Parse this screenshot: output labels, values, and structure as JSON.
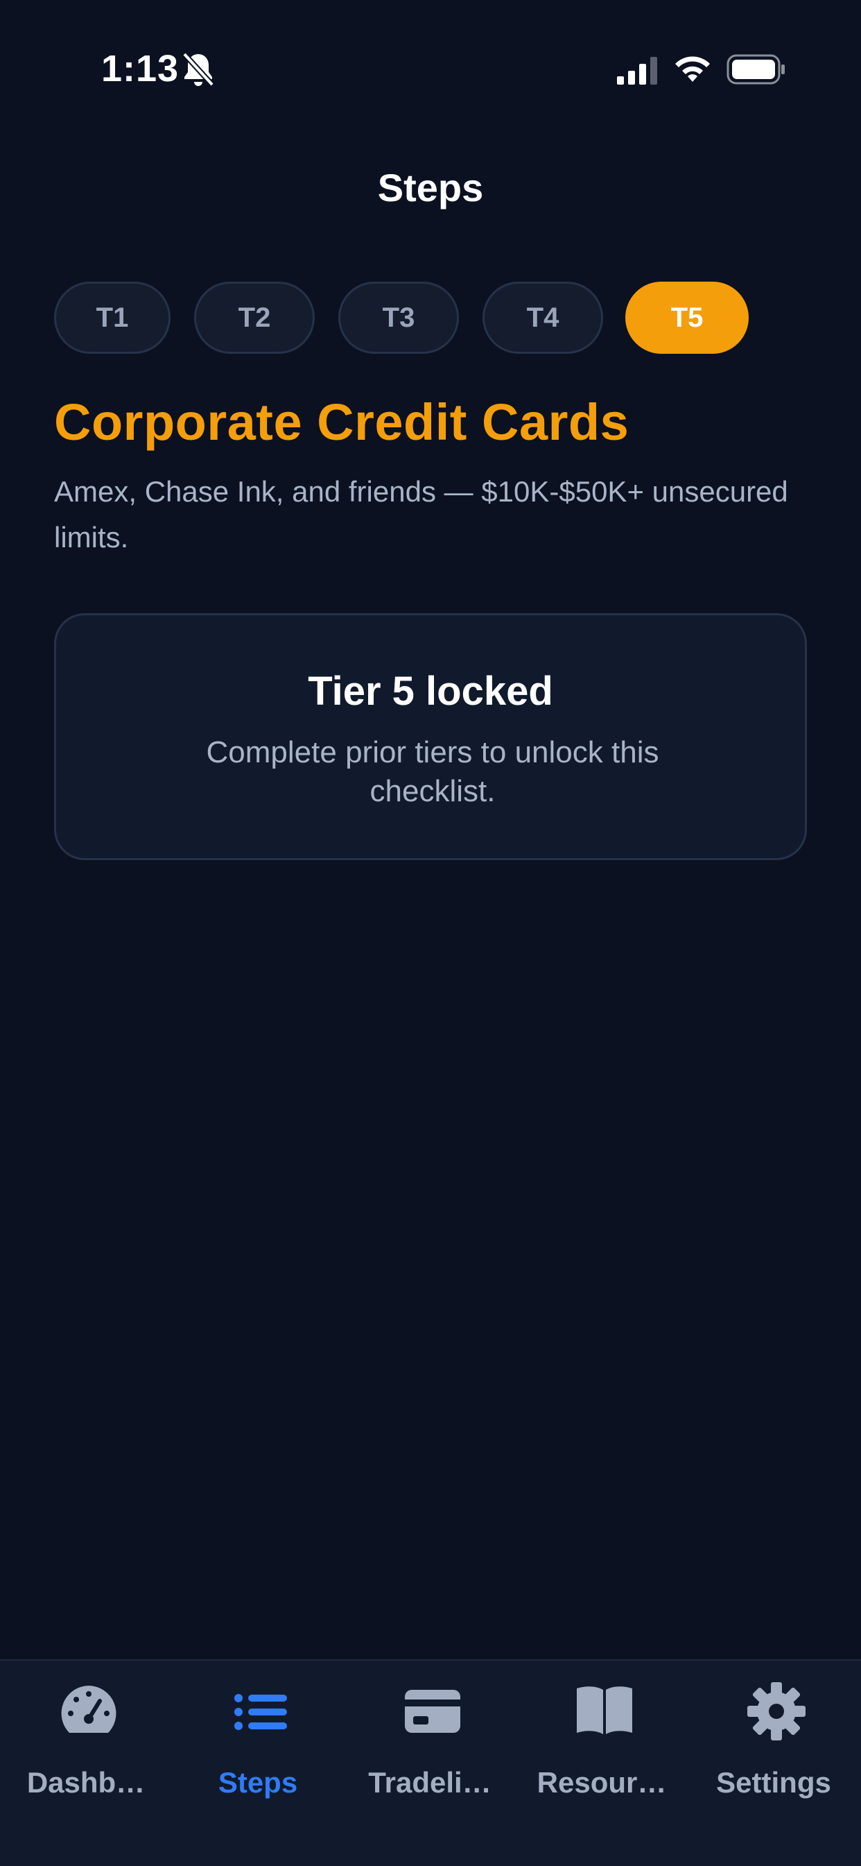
{
  "status_bar": {
    "time": "1:13"
  },
  "header": {
    "title": "Steps"
  },
  "tier_tabs": [
    {
      "label": "T1",
      "active": false
    },
    {
      "label": "T2",
      "active": false
    },
    {
      "label": "T3",
      "active": false
    },
    {
      "label": "T4",
      "active": false
    },
    {
      "label": "T5",
      "active": true
    }
  ],
  "tier": {
    "heading": "Corporate Credit Cards",
    "description": "Amex, Chase Ink, and friends — $10K-$50K+ unsecured limits."
  },
  "locked_card": {
    "title": "Tier 5 locked",
    "message": "Complete prior tiers to unlock this checklist."
  },
  "tab_bar": {
    "items": [
      {
        "label": "Dashb…",
        "icon": "speedometer-icon",
        "active": false
      },
      {
        "label": "Steps",
        "icon": "list-icon",
        "active": true
      },
      {
        "label": "Tradeli…",
        "icon": "credit-card-icon",
        "active": false
      },
      {
        "label": "Resour…",
        "icon": "book-icon",
        "active": false
      },
      {
        "label": "Settings",
        "icon": "gear-icon",
        "active": false
      }
    ]
  },
  "colors": {
    "background": "#0b1120",
    "accent": "#f59e0b",
    "active_tab": "#2f7cf6",
    "muted_text": "#a9b4c8"
  }
}
